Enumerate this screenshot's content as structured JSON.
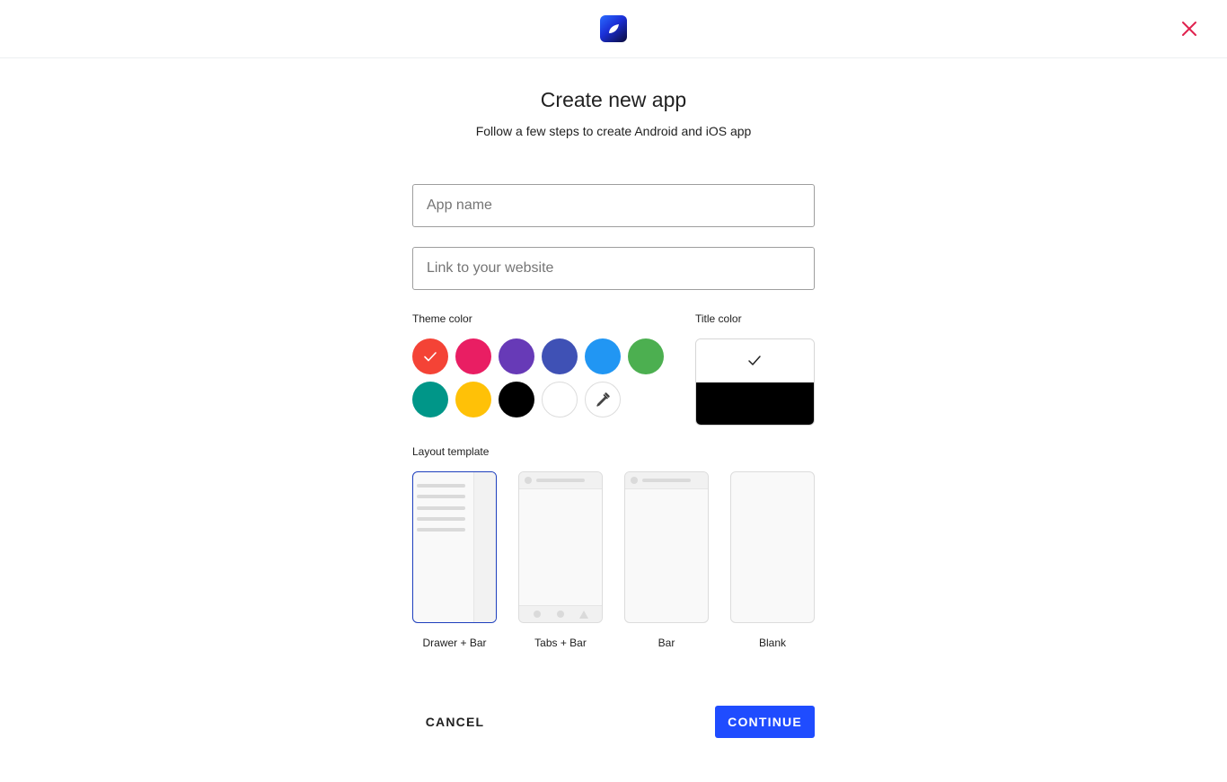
{
  "header": {
    "logo_icon": "app-logo-icon",
    "close_icon": "close-icon",
    "close_color": "#e0224e"
  },
  "title": "Create new app",
  "subtitle": "Follow a few steps to create Android and iOS app",
  "form": {
    "app_name": {
      "value": "",
      "placeholder": "App name"
    },
    "website": {
      "value": "",
      "placeholder": "Link to your website"
    }
  },
  "theme_color": {
    "label": "Theme color",
    "selected": "red",
    "swatches": [
      {
        "name": "red",
        "color": "#f44336"
      },
      {
        "name": "pink",
        "color": "#e91e63"
      },
      {
        "name": "purple",
        "color": "#673ab7"
      },
      {
        "name": "indigo",
        "color": "#3f51b5"
      },
      {
        "name": "blue",
        "color": "#2196f3"
      },
      {
        "name": "green",
        "color": "#4caf50"
      },
      {
        "name": "teal",
        "color": "#009688"
      },
      {
        "name": "amber",
        "color": "#ffc107"
      },
      {
        "name": "black",
        "color": "#000000"
      },
      {
        "name": "white",
        "color": "#ffffff"
      }
    ],
    "custom_picker_icon": "eyedropper-icon"
  },
  "title_color": {
    "label": "Title color",
    "options": [
      {
        "name": "white",
        "color": "#ffffff"
      },
      {
        "name": "black",
        "color": "#000000"
      }
    ],
    "selected": "white"
  },
  "layout_template": {
    "label": "Layout template",
    "selected": "Drawer + Bar",
    "options": [
      {
        "label": "Drawer + Bar"
      },
      {
        "label": "Tabs + Bar"
      },
      {
        "label": "Bar"
      },
      {
        "label": "Blank"
      }
    ]
  },
  "actions": {
    "cancel": "CANCEL",
    "continue": "CONTINUE"
  },
  "colors": {
    "accent": "#1f4cff",
    "selected_outline": "#1e3fbd"
  }
}
